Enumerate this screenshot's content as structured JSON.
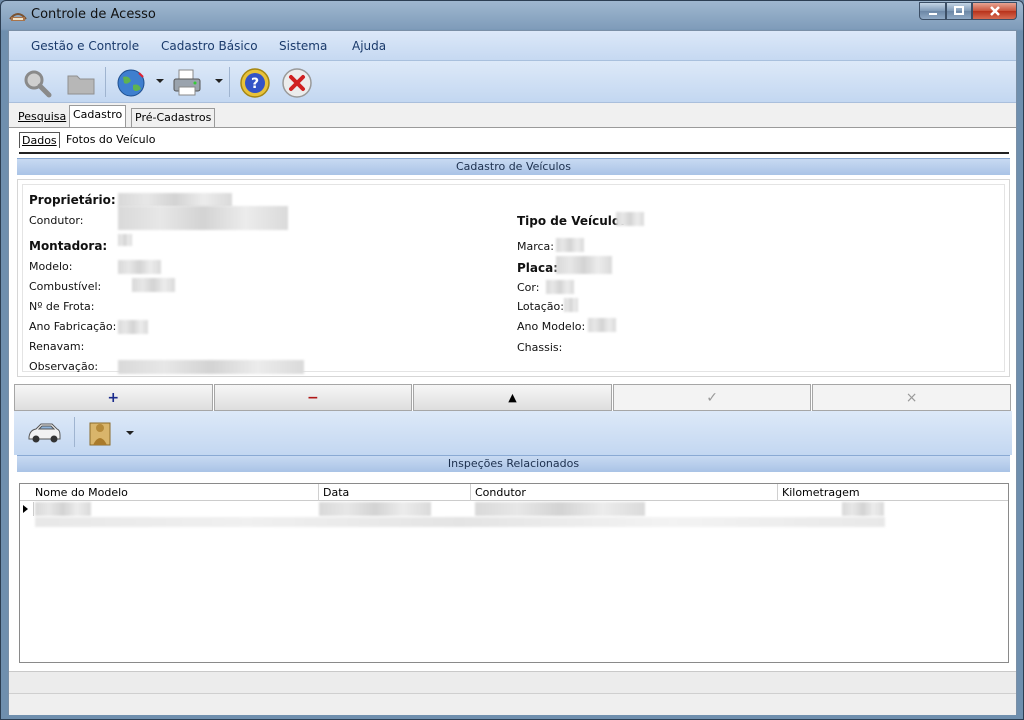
{
  "window": {
    "title": "Controle de Acesso"
  },
  "menu": {
    "items": [
      "Gestão e Controle",
      "Cadastro Básico",
      "Sistema",
      "Ajuda"
    ]
  },
  "toolbar": {
    "icons": [
      "search-icon",
      "folder-icon",
      "globe-icon",
      "printer-icon",
      "help-icon",
      "cancel-icon"
    ]
  },
  "tabs": [
    {
      "label": "Pesquisa"
    },
    {
      "label": "Cadastro"
    },
    {
      "label": "Pré-Cadastros"
    }
  ],
  "subtabs": [
    {
      "label": "Dados"
    },
    {
      "label": "Fotos do Veículo"
    }
  ],
  "form": {
    "header": "Cadastro de Veículos",
    "left": {
      "proprietario": "Proprietário:",
      "condutor": "Condutor:",
      "montadora": "Montadora:",
      "modelo": "Modelo:",
      "combustivel": "Combustível:",
      "frota": "Nº de Frota:",
      "ano_fabricacao": "Ano Fabricação:",
      "renavam": "Renavam:",
      "observacao": "Observação:"
    },
    "right": {
      "tipo_veiculo": "Tipo de Veículo:",
      "marca": "Marca:",
      "placa": "Placa:",
      "cor": "Cor:",
      "lotacao": "Lotação:",
      "ano_modelo": "Ano Modelo:",
      "chassis": "Chassis:"
    }
  },
  "actions": {
    "add": "+",
    "remove": "−",
    "up": "▲",
    "confirm": "✓",
    "cancel": "×"
  },
  "toolbar2": {
    "icons": [
      "car-icon",
      "person-icon"
    ]
  },
  "inspections": {
    "header": "Inspeções Relacionados",
    "columns": [
      "Nome do Modelo",
      "Data",
      "Condutor",
      "Kilometragem"
    ]
  },
  "colors": {
    "accent": "#a9c3e6",
    "toolbar": "#c3d7f1",
    "menu_text": "#1a3a6b"
  }
}
